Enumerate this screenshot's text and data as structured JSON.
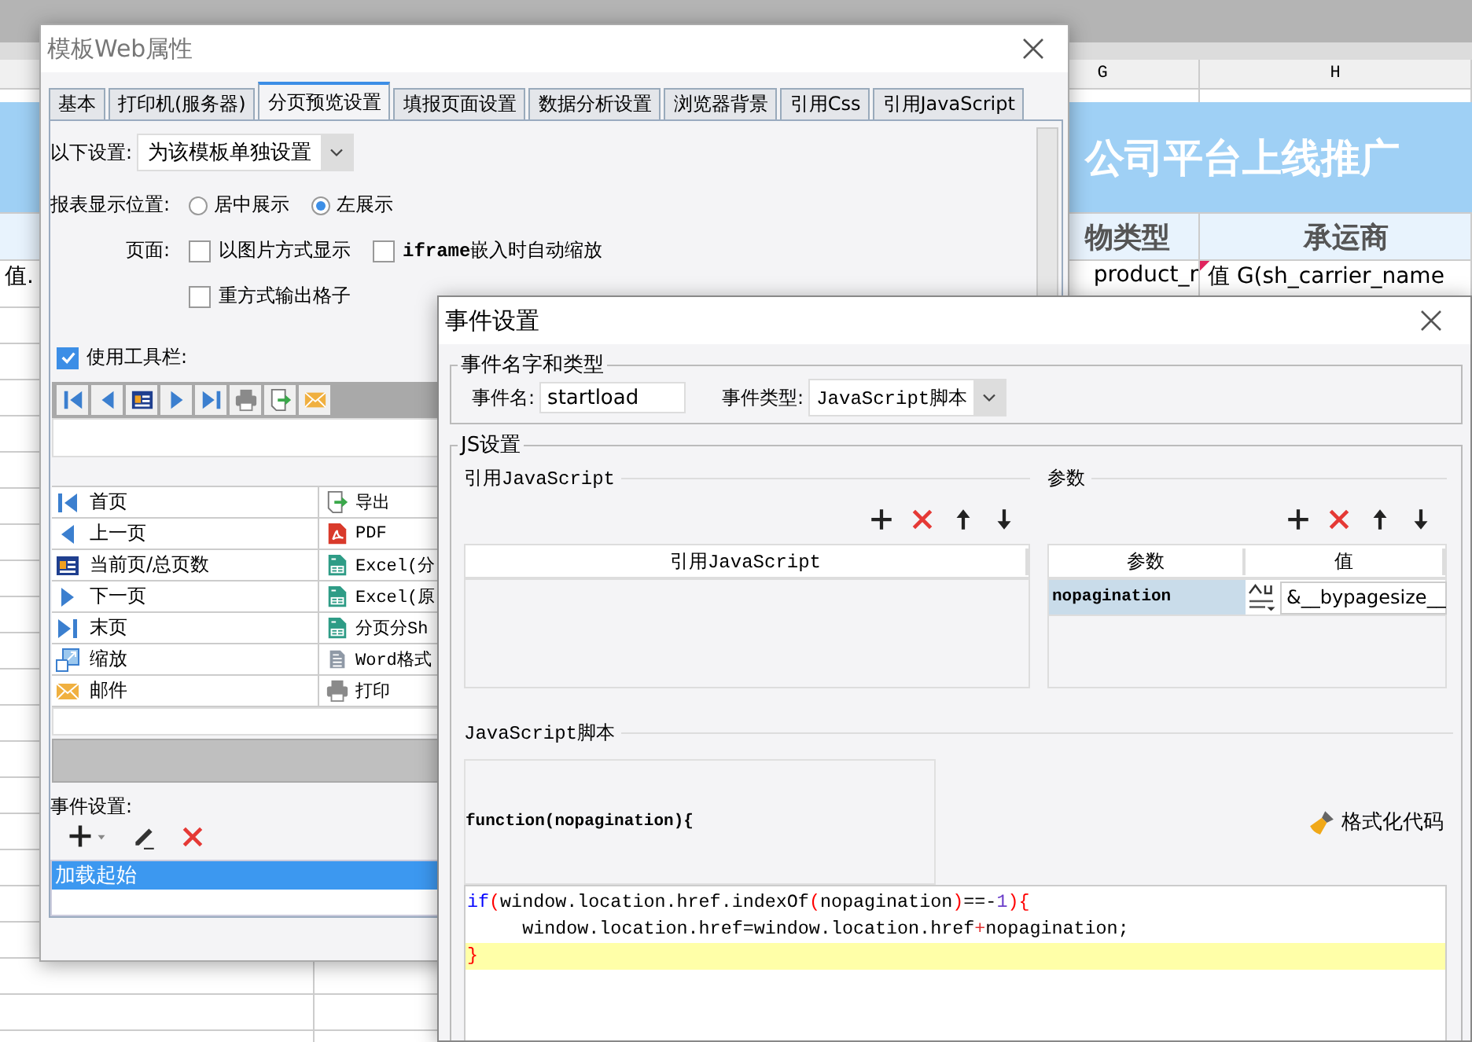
{
  "sheet": {
    "columns": [
      {
        "label": "G"
      },
      {
        "label": "H"
      }
    ],
    "title": "公司平台上线推广",
    "header_cells": [
      "物类型",
      "承运商"
    ],
    "data_cells": [
      "值.",
      "product_r",
      "值 G(sh_carrier_name"
    ]
  },
  "web_properties": {
    "title": "模板Web属性",
    "tabs": [
      {
        "label": "基本",
        "selected": false
      },
      {
        "label": "打印机(服务器)",
        "selected": false
      },
      {
        "label": "分页预览设置",
        "selected": true
      },
      {
        "label": "填报页面设置",
        "selected": false
      },
      {
        "label": "数据分析设置",
        "selected": false
      },
      {
        "label": "浏览器背景",
        "selected": false
      },
      {
        "label": "引用Css",
        "selected": false
      },
      {
        "label": "引用JavaScript",
        "selected": false
      }
    ],
    "settings_label": "以下设置:",
    "settings_value": "为该模板单独设置",
    "position_label": "报表显示位置:",
    "position_options": [
      {
        "label": "居中展示",
        "selected": false
      },
      {
        "label": "左展示",
        "selected": true
      }
    ],
    "page_label": "页面:",
    "page_options": [
      {
        "label": "以图片方式显示",
        "checked": false
      },
      {
        "label": "**iframe**嵌入时自动缩放",
        "checked": false
      },
      {
        "label": "重方式输出格子",
        "checked": false
      }
    ],
    "use_toolbar": {
      "label": "使用工具栏:",
      "checked": true
    },
    "toolbar_buttons": [
      {
        "kind": "first"
      },
      {
        "kind": "prev"
      },
      {
        "kind": "page"
      },
      {
        "kind": "next"
      },
      {
        "kind": "last"
      },
      {
        "kind": "print"
      },
      {
        "kind": "export"
      },
      {
        "kind": "mail"
      }
    ],
    "toolbar_items": [
      {
        "left": {
          "kind": "first",
          "label": "首页"
        },
        "right": {
          "kind": "export",
          "label": "导出"
        }
      },
      {
        "left": {
          "kind": "prev",
          "label": "上一页"
        },
        "right": {
          "kind": "pdf",
          "label": "PDF"
        }
      },
      {
        "left": {
          "kind": "page",
          "label": "当前页/总页数"
        },
        "right": {
          "kind": "excel",
          "label": "Excel(分"
        }
      },
      {
        "left": {
          "kind": "next",
          "label": "下一页"
        },
        "right": {
          "kind": "excel",
          "label": "Excel(原"
        }
      },
      {
        "left": {
          "kind": "last",
          "label": "末页"
        },
        "right": {
          "kind": "excel",
          "label": "分页分Sh"
        }
      },
      {
        "left": {
          "kind": "zoom",
          "label": "缩放"
        },
        "right": {
          "kind": "word",
          "label": "Word格式"
        }
      },
      {
        "left": {
          "kind": "mail",
          "label": "邮件"
        },
        "right": {
          "kind": "print",
          "label": "打印"
        }
      }
    ],
    "events_label": "事件设置:",
    "events": [
      {
        "label": "加载起始",
        "selected": true
      }
    ]
  },
  "event_settings": {
    "title": "事件设置",
    "name_group": "事件名字和类型",
    "name_label": "事件名:",
    "name_value": "startload",
    "type_label": "事件类型:",
    "type_value": "JavaScript脚本",
    "js_group": "JS设置",
    "ref_title": "引用JavaScript",
    "ref_column": "引用JavaScript",
    "params_title": "参数",
    "params_columns": [
      "参数",
      "值"
    ],
    "params": [
      {
        "name": "nopagination",
        "value": "&__bypagesize__",
        "selected": true
      }
    ],
    "script_title": "JavaScript脚本",
    "function_header": "function(nopagination){",
    "format_button": "格式化代码",
    "code_lines": [
      {
        "highlighted": false,
        "tokens": [
          {
            "kind": "keyword",
            "text": "if"
          },
          {
            "kind": "bracket",
            "text": "("
          },
          {
            "kind": "text",
            "text": "window.location.href.indexOf"
          },
          {
            "kind": "bracket",
            "text": "("
          },
          {
            "kind": "text",
            "text": "nopagination"
          },
          {
            "kind": "bracket",
            "text": ")"
          },
          {
            "kind": "text",
            "text": "==-"
          },
          {
            "kind": "number",
            "text": "1"
          },
          {
            "kind": "bracket",
            "text": ")"
          },
          {
            "kind": "bracket",
            "text": "{"
          }
        ]
      },
      {
        "highlighted": false,
        "tokens": [
          {
            "kind": "text",
            "text": "     window.location.href=window.location.href"
          },
          {
            "kind": "operator",
            "text": "+"
          },
          {
            "kind": "text",
            "text": "nopagination;"
          }
        ]
      },
      {
        "highlighted": true,
        "tokens": [
          {
            "kind": "bracket",
            "text": "}"
          }
        ]
      }
    ]
  }
}
